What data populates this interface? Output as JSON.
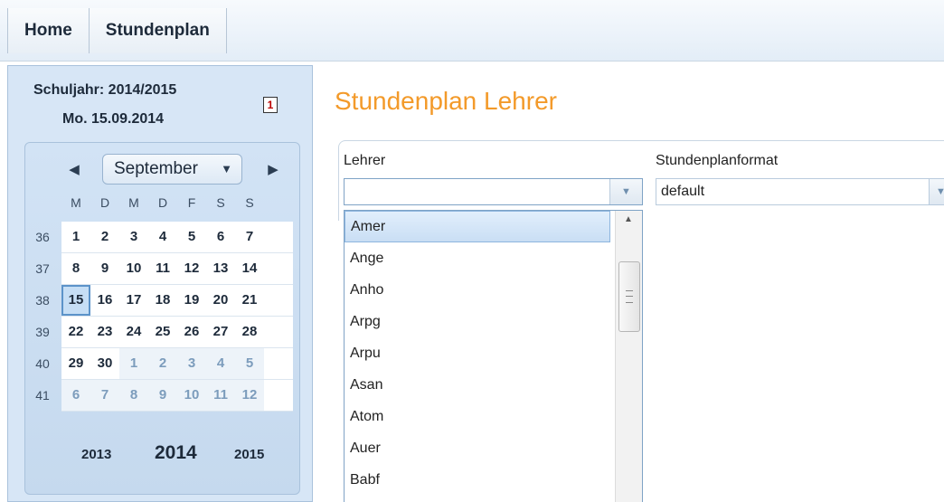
{
  "nav": {
    "tabs": [
      "Home",
      "Stundenplan"
    ]
  },
  "sidebar": {
    "school_year": "Schuljahr: 2014/2015",
    "current_date": "Mo. 15.09.2014",
    "today_icon_text": "1",
    "calendar": {
      "month": "September",
      "day_headers": [
        "M",
        "D",
        "M",
        "D",
        "F",
        "S",
        "S"
      ],
      "weeks": [
        {
          "num": "36",
          "days": [
            "1",
            "2",
            "3",
            "4",
            "5",
            "6",
            "7"
          ]
        },
        {
          "num": "37",
          "days": [
            "8",
            "9",
            "10",
            "11",
            "12",
            "13",
            "14"
          ]
        },
        {
          "num": "38",
          "days": [
            "15",
            "16",
            "17",
            "18",
            "19",
            "20",
            "21"
          ]
        },
        {
          "num": "39",
          "days": [
            "22",
            "23",
            "24",
            "25",
            "26",
            "27",
            "28"
          ]
        },
        {
          "num": "40",
          "days": [
            "29",
            "30",
            "1",
            "2",
            "3",
            "4",
            "5"
          ]
        },
        {
          "num": "41",
          "days": [
            "6",
            "7",
            "8",
            "9",
            "10",
            "11",
            "12"
          ]
        }
      ],
      "selected_day": "15",
      "years": [
        "2013",
        "2014",
        "2015"
      ]
    }
  },
  "main": {
    "title": "Stundenplan Lehrer",
    "lehrer_label": "Lehrer",
    "lehrer_value": "",
    "format_label": "Stundenplanformat",
    "format_value": "default",
    "dropdown_items": [
      "Amer",
      "Ange",
      "Anho",
      "Arpg",
      "Arpu",
      "Asan",
      "Atom",
      "Auer",
      "Babf"
    ],
    "highlighted_item": "Amer"
  },
  "colors": {
    "title": "#f39a2a",
    "calendar_bg": "#d7e6f6",
    "selection": "#5c93c9"
  }
}
